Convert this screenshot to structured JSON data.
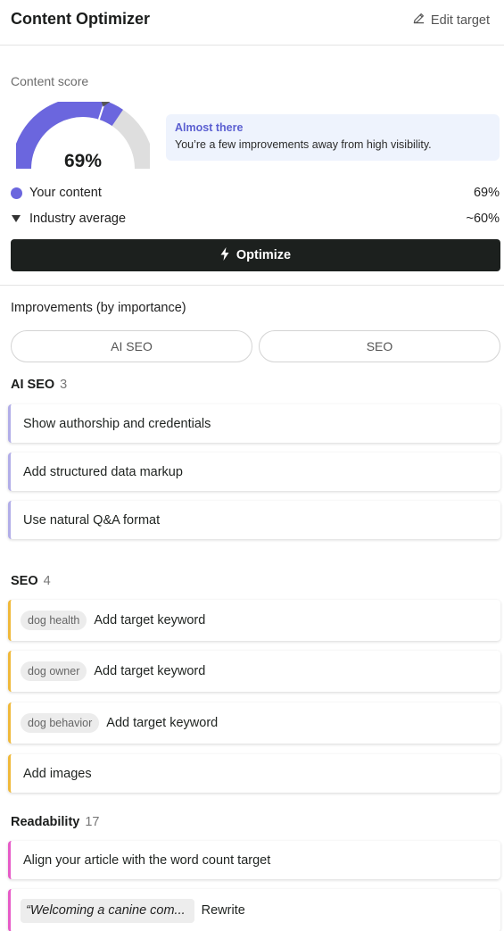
{
  "header": {
    "title": "Content Optimizer",
    "edit_label": "Edit target"
  },
  "score": {
    "label": "Content score",
    "value_text": "69%",
    "value": 69,
    "industry_average": 60,
    "callout_title": "Almost there",
    "callout_text": "You’re a few improvements away from high visibility.",
    "colors": {
      "your_content": "#6b66de",
      "track": "#dedede",
      "marker": "#555555"
    }
  },
  "legend": [
    {
      "label": "Your content",
      "value": "69%"
    },
    {
      "label": "Industry average",
      "value": "~60%"
    }
  ],
  "optimize_label": "Optimize",
  "improvements_label": "Improvements (by importance)",
  "tabs": [
    "AI SEO",
    "SEO"
  ],
  "sections": {
    "ai_seo": {
      "title": "AI SEO",
      "count": "3",
      "items": [
        "Show authorship and credentials",
        "Add structured data markup",
        "Use natural Q&A format"
      ]
    },
    "seo": {
      "title": "SEO",
      "count": "4",
      "items": [
        {
          "chip": "dog health",
          "text": "Add target keyword"
        },
        {
          "chip": "dog owner",
          "text": "Add target keyword"
        },
        {
          "chip": "dog behavior",
          "text": "Add target keyword"
        },
        {
          "text": "Add images"
        }
      ]
    },
    "readability": {
      "title": "Readability",
      "count": "17",
      "items": [
        {
          "text": "Align your article with the word count target"
        },
        {
          "quote": "“Welcoming a canine com...",
          "text": "Rewrite"
        }
      ]
    }
  }
}
